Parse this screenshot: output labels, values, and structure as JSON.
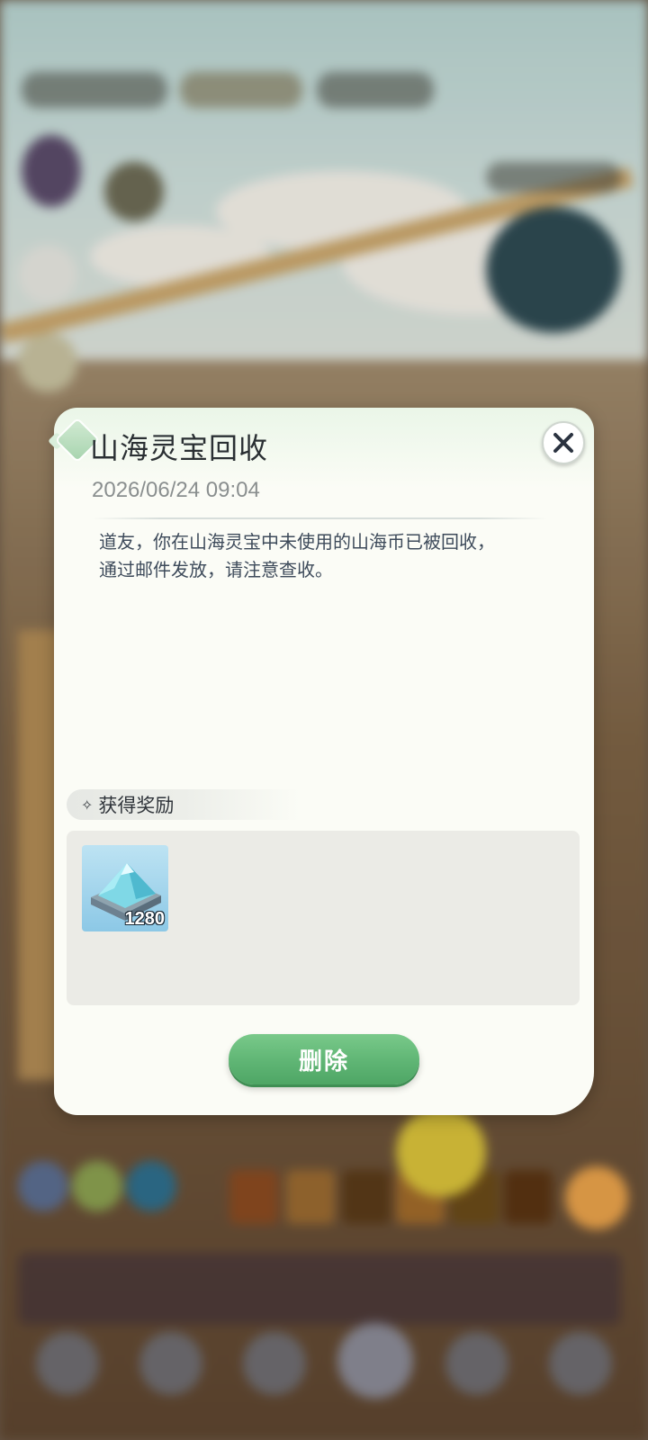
{
  "dialog": {
    "title": "山海灵宝回收",
    "date": "2026/06/24 09:04",
    "message_line1": "道友，你在山海灵宝中未使用的山海币已被回收，",
    "message_line2": "通过邮件发放，请注意查收。",
    "rewards_label": "获得奖励",
    "rewards": [
      {
        "icon": "mountain-coin-icon",
        "count": "1280"
      }
    ],
    "delete_label": "删除",
    "close_icon": "close-icon"
  },
  "colors": {
    "delete_button": "#5fb574",
    "title_text": "#2a2f33",
    "body_text": "#3d4a5a"
  }
}
